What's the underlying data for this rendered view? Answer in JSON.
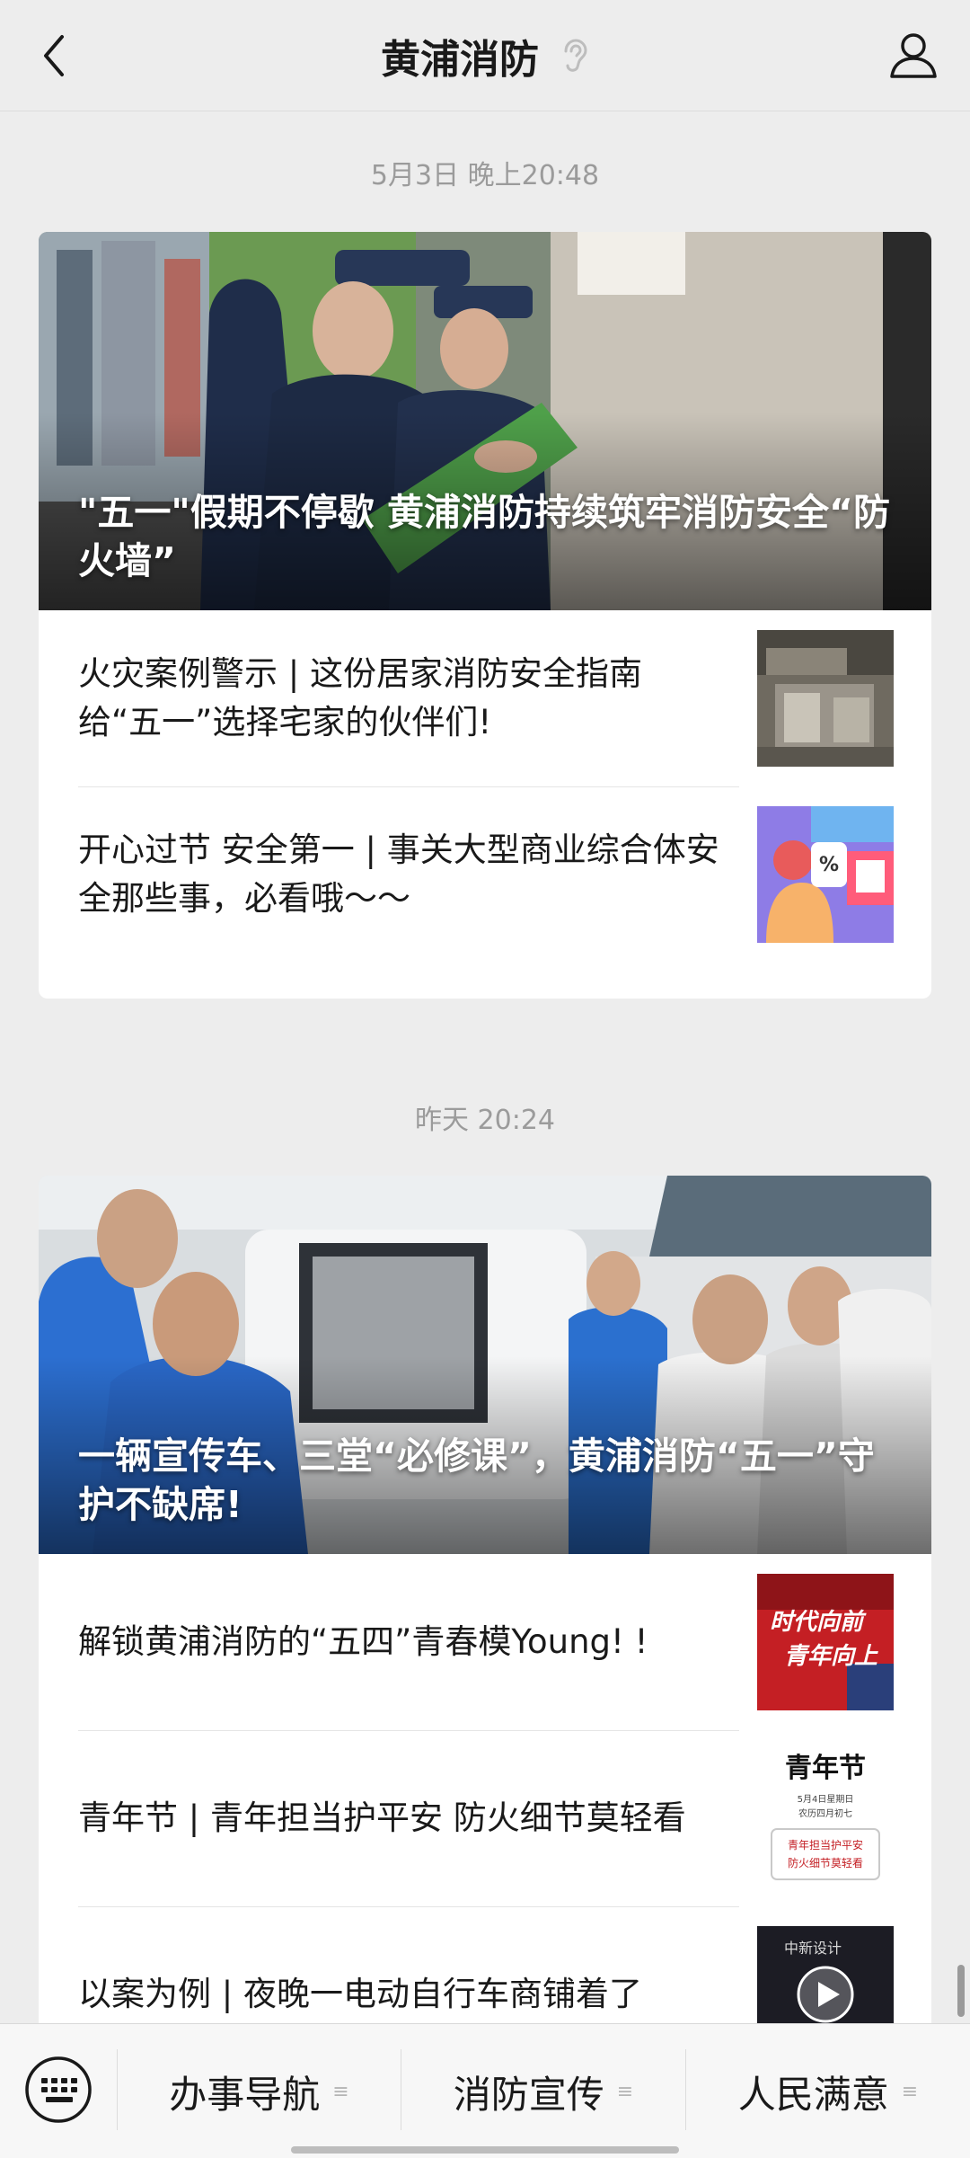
{
  "header": {
    "title": "黄浦消防",
    "back_icon": "chevron-left-icon",
    "listen_icon": "ear-icon",
    "profile_icon": "person-icon"
  },
  "groups": [
    {
      "timestamp": "5月3日 晚上20:48",
      "main_title": "\"五一\"假期不停歇 黄浦消防持续筑牢消防安全“防火墙”",
      "items": [
        {
          "title": "火灾案例警示 | 这份居家消防安全指南给“五一”选择宅家的伙伴们!"
        },
        {
          "title": "开心过节 安全第一 | 事关大型商业综合体安全那些事，必看哦～～"
        }
      ]
    },
    {
      "timestamp": "昨天 20:24",
      "main_title": "一辆宣传车、三堂“必修课”，黄浦消防“五一”守护不缺席!",
      "items": [
        {
          "title": "解锁黄浦消防的“五四”青春模Young! !",
          "thumb_text_1": "时代向前",
          "thumb_text_2": "青年向上"
        },
        {
          "title": "青年节 | 青年担当护平安 防火细节莫轻看",
          "thumb_title": "青年节",
          "thumb_date_1": "5月4日星期日",
          "thumb_date_2": "农历四月初七",
          "thumb_tag_1": "青年担当护平安",
          "thumb_tag_2": "防火细节莫轻看"
        },
        {
          "title": "以案为例 | 夜晚一电动自行车商铺着了",
          "thumb_label": "中新设计"
        }
      ]
    }
  ],
  "bottom_menu": {
    "keyboard_icon": "keyboard-icon",
    "items": [
      {
        "label": "办事导航"
      },
      {
        "label": "消防宣传"
      },
      {
        "label": "人民满意"
      }
    ]
  },
  "colors": {
    "background": "#ededed",
    "card": "#ffffff",
    "timestamp": "#9b9b9b"
  }
}
